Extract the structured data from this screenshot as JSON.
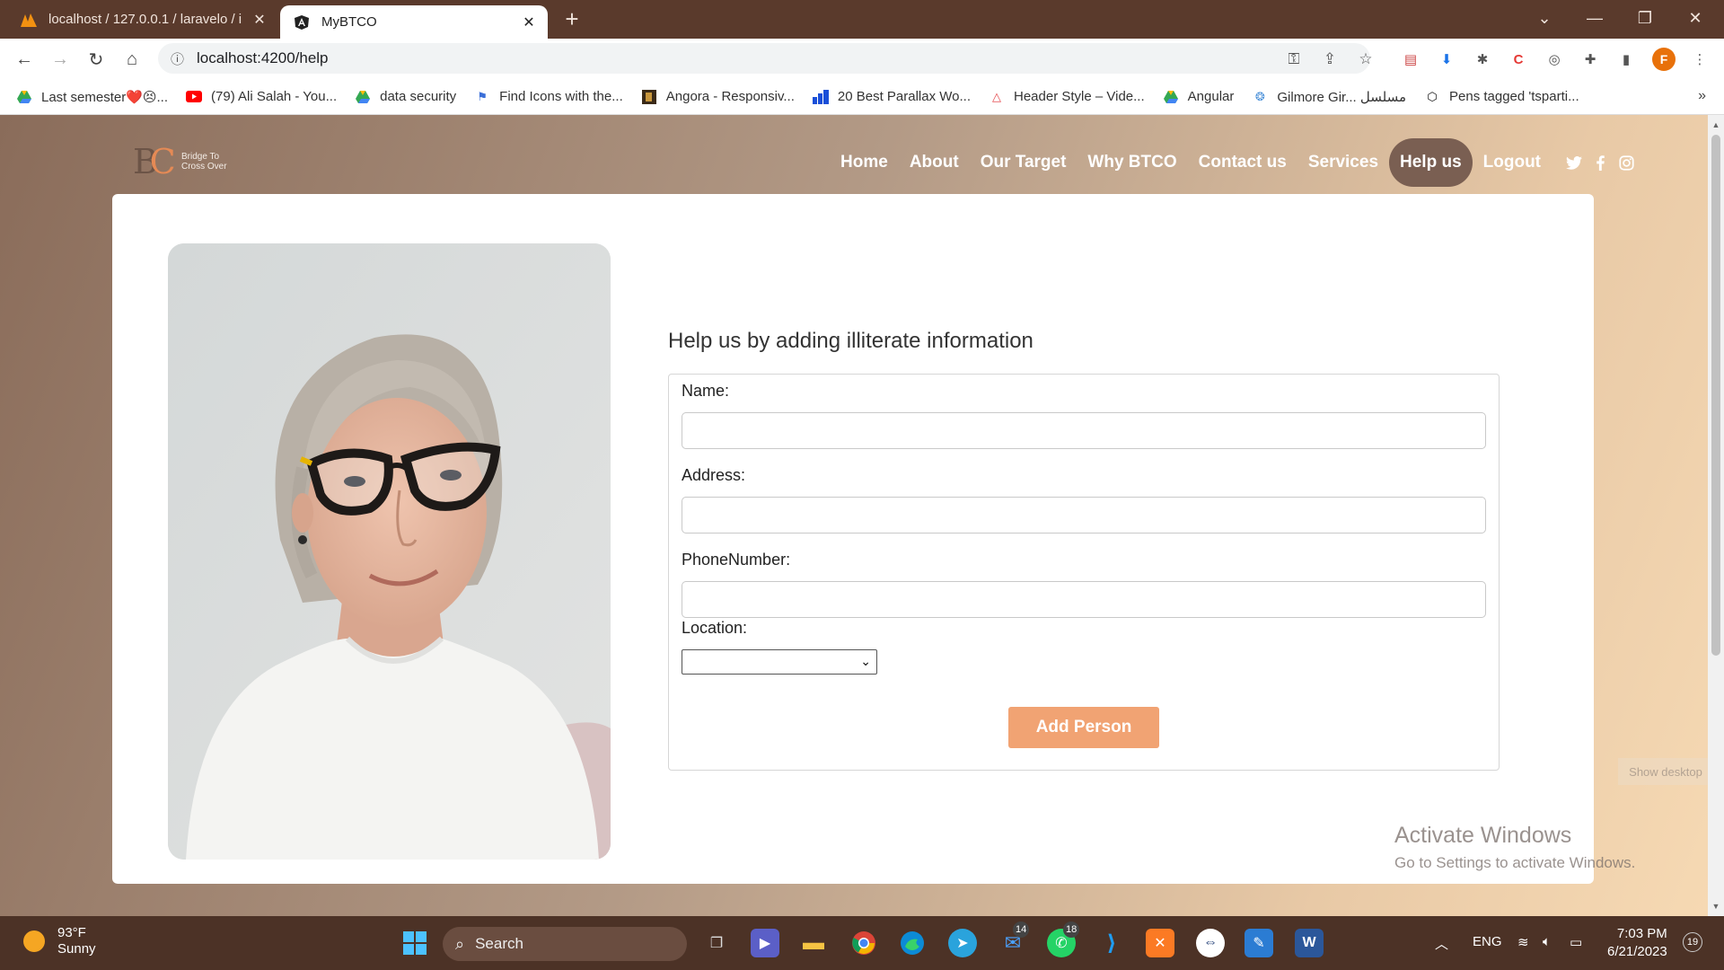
{
  "browser": {
    "tabs": [
      {
        "title": "localhost / 127.0.0.1 / laravelo / i",
        "active": false
      },
      {
        "title": "MyBTCO",
        "active": true
      }
    ],
    "url": "localhost:4200/help",
    "bookmarks": [
      {
        "label": "Last semester❤️😣...",
        "icon": "google-drive-icon"
      },
      {
        "label": "(79) Ali Salah - You...",
        "icon": "youtube-icon"
      },
      {
        "label": "data security",
        "icon": "google-drive-icon"
      },
      {
        "label": "Find Icons with the...",
        "icon": "flag-icon"
      },
      {
        "label": "Angora - Responsiv...",
        "icon": "angora-icon"
      },
      {
        "label": "20 Best Parallax Wo...",
        "icon": "chart-icon"
      },
      {
        "label": "Header Style – Vide...",
        "icon": "triangle-icon"
      },
      {
        "label": "Angular",
        "icon": "google-drive-icon"
      },
      {
        "label": "Gilmore Gir... مسلسل",
        "icon": "globe-icon"
      },
      {
        "label": "Pens tagged 'tsparti...",
        "icon": "codepen-icon"
      }
    ],
    "profile_initial": "F",
    "colors": {
      "tabstrip": "#5a3a2c",
      "profile": "#e8710a"
    }
  },
  "site": {
    "logo_tagline_1": "Bridge To",
    "logo_tagline_2": "Cross Over",
    "nav": [
      {
        "label": "Home",
        "active": false
      },
      {
        "label": "About",
        "active": false
      },
      {
        "label": "Our Target",
        "active": false
      },
      {
        "label": "Why BTCO",
        "active": false
      },
      {
        "label": "Contact us",
        "active": false
      },
      {
        "label": "Services",
        "active": false
      },
      {
        "label": "Help us",
        "active": true
      },
      {
        "label": "Logout",
        "active": false
      }
    ],
    "social_icons": [
      "twitter-icon",
      "facebook-icon",
      "instagram-icon"
    ],
    "colors": {
      "accent": "#f1a373",
      "nav_active": "#7a5f52"
    }
  },
  "form": {
    "title": "Help us by adding illiterate information",
    "name_label": "Name:",
    "name_value": "",
    "address_label": "Address:",
    "address_value": "",
    "phone_label": "PhoneNumber:",
    "phone_value": "",
    "location_label": "Location:",
    "location_selected": "",
    "submit_label": "Add Person"
  },
  "watermark": {
    "line1": "Activate Windows",
    "line2": "Go to Settings to activate Windows.",
    "show_desktop": "Show desktop"
  },
  "taskbar": {
    "temperature": "93°F",
    "condition": "Sunny",
    "search_placeholder": "Search",
    "badges": {
      "mail": "14",
      "whatsapp": "18"
    },
    "language": "ENG",
    "time": "7:03 PM",
    "date": "6/21/2023",
    "notification_count": "19"
  }
}
